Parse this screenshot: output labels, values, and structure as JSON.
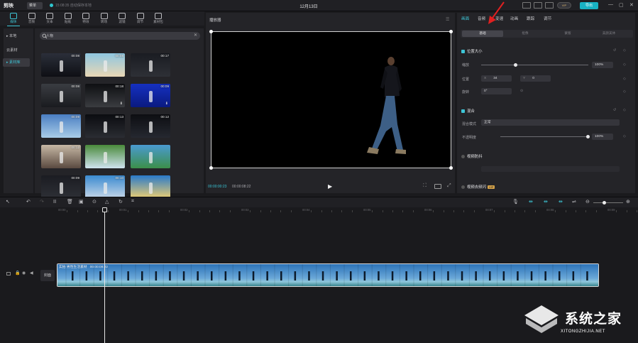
{
  "app": {
    "logo": "剪映",
    "menu_label": "菜单",
    "autosave": "15:08:35 自动保存本地",
    "project_title": "12月13日",
    "vip_label": "VIP",
    "export_label": "导出",
    "window_controls": [
      "—",
      "▢",
      "✕"
    ]
  },
  "toolbar": {
    "tools": [
      {
        "label": "媒体",
        "icon": "media-icon",
        "active": true
      },
      {
        "label": "音频",
        "icon": "audio-icon"
      },
      {
        "label": "文本",
        "icon": "text-icon"
      },
      {
        "label": "贴纸",
        "icon": "sticker-icon"
      },
      {
        "label": "特效",
        "icon": "effects-icon"
      },
      {
        "label": "转场",
        "icon": "transition-icon"
      },
      {
        "label": "滤镜",
        "icon": "filter-icon"
      },
      {
        "label": "调节",
        "icon": "adjust-icon"
      },
      {
        "label": "素材包",
        "icon": "package-icon"
      }
    ]
  },
  "leftnav": {
    "items": [
      {
        "label": "▸ 本地"
      },
      {
        "label": "云素材"
      },
      {
        "label": "▸ 素材库",
        "active": true
      }
    ]
  },
  "library": {
    "search_value": "人物",
    "items": [
      {
        "duration": "00:08"
      },
      {
        "duration": "00:08"
      },
      {
        "duration": "00:17"
      },
      {
        "duration": "00:08"
      },
      {
        "duration": "00:18"
      },
      {
        "duration": "00:09"
      },
      {
        "duration": "00:09"
      },
      {
        "duration": "00:13"
      },
      {
        "duration": "00:12"
      },
      {
        "duration": "00:12"
      },
      {
        "duration": ""
      },
      {
        "duration": ""
      },
      {
        "duration": "00:09"
      },
      {
        "duration": "00:10"
      },
      {
        "duration": ""
      }
    ]
  },
  "player": {
    "title": "播放器",
    "time_current": "00:00:00:23",
    "time_total": "00:00:08:22"
  },
  "rpanel": {
    "tabs": [
      "画面",
      "音频",
      "变速",
      "动画",
      "跟踪",
      "调节"
    ],
    "subtabs": [
      "基础",
      "抠像",
      "蒙版",
      "美颜美体"
    ],
    "position_section": "位置大小",
    "scale_label": "缩放",
    "scale_value": "100%",
    "position_label": "位置",
    "pos_x_label": "X",
    "pos_x": "34",
    "pos_y_label": "Y",
    "pos_y": "0",
    "rotate_label": "旋转",
    "rotate_value": "0°",
    "blend_section": "混合",
    "blend_mode_label": "混合模式",
    "blend_mode_value": "正常",
    "opacity_label": "不透明度",
    "opacity_value": "100%",
    "stabilize_label": "视频防抖",
    "denoise_label": "视频去频闪",
    "denoise_badge": "VIP",
    "scale_fraction": 0.32,
    "opacity_fraction": 1.0
  },
  "timeline": {
    "ruler_labels": [
      "00:00",
      "00:01",
      "00:02",
      "00:03",
      "00:04",
      "00:05",
      "00:06",
      "00:07",
      "00:08",
      "00:09"
    ],
    "cover_label": "封面",
    "clip_name": "实拍 男性生活素材",
    "clip_duration": "00:00:08:22"
  },
  "watermark": {
    "text": "系统之家",
    "url": "XITONGZHIJIA.NET"
  },
  "colors": {
    "accent": "#3dc5d6",
    "export": "#18b2c4",
    "background": "#1a1a1d",
    "panel": "#242428",
    "arrow": "#e02020"
  }
}
